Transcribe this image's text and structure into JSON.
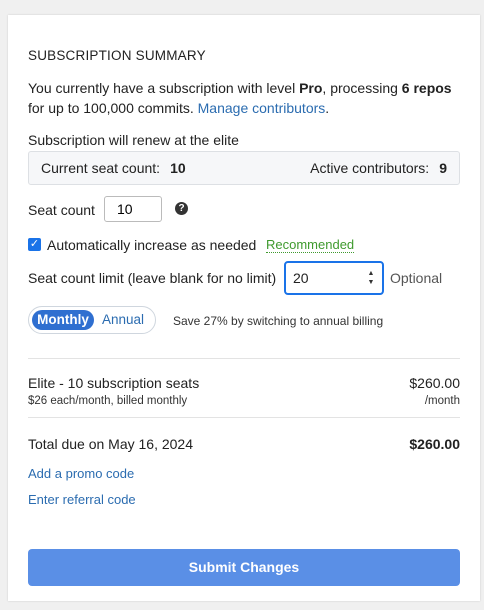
{
  "summary": {
    "heading": "SUBSCRIPTION SUMMARY",
    "intro_prefix": "You currently have a subscription with level ",
    "intro_level": "Pro",
    "intro_mid": ", processing ",
    "intro_repos": "6 repos",
    "intro_suffix": " for up to 100,000 commits. ",
    "manage_link": "Manage contributors",
    "intro_end": "."
  },
  "renewal": {
    "text": "Subscription will renew at the elite",
    "current_seat_label": "Current seat count:",
    "current_seat_value": "10",
    "active_label": "Active contributors:",
    "active_value": "9"
  },
  "seat": {
    "label": "Seat count",
    "value": "10",
    "help_icon": "question-circle-icon"
  },
  "auto": {
    "checked": true,
    "label": "Automatically increase as needed",
    "badge": "Recommended"
  },
  "limit": {
    "label": "Seat count limit (leave blank for no limit)",
    "value": "20",
    "optional": "Optional"
  },
  "billing": {
    "monthly": "Monthly",
    "annual": "Annual",
    "selected": "Monthly",
    "savings": "Save 27% by switching to annual billing"
  },
  "line_item": {
    "title": "Elite - 10 subscription seats",
    "subtitle": "$26 each/month, billed monthly",
    "price": "$260.00",
    "period": "/month"
  },
  "total": {
    "label": "Total due on May 16, 2024",
    "amount": "$260.00"
  },
  "links": {
    "promo": "Add a promo code",
    "referral": "Enter referral code"
  },
  "submit_label": "Submit Changes",
  "colors": {
    "accent": "#1a73e8",
    "link": "#2b6cb0",
    "recommended": "#3f9a2e",
    "submit_bg": "#5a8fe6"
  }
}
